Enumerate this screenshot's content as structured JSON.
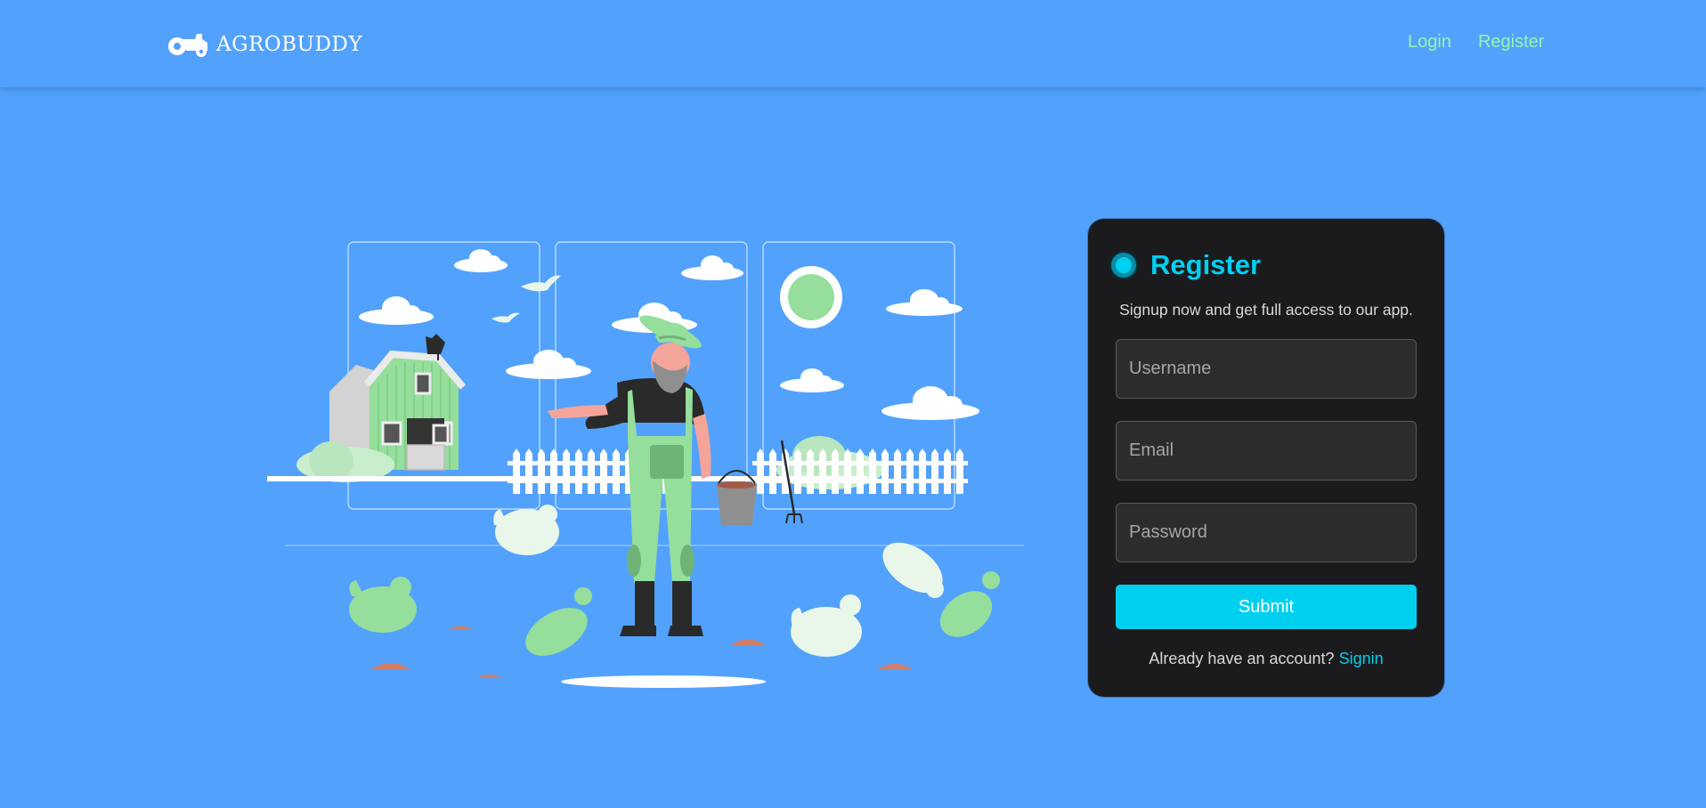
{
  "nav": {
    "brand": "AGROBUDDY",
    "login": "Login",
    "register": "Register"
  },
  "form": {
    "title": "Register",
    "subtitle": "Signup now and get full access to our app.",
    "username_placeholder": "Username",
    "email_placeholder": "Email",
    "password_placeholder": "Password",
    "submit_label": "Submit",
    "footer_text": "Already have an account?",
    "signin_label": "Signin"
  },
  "colors": {
    "background": "#52a2fd",
    "card": "#1b1b1d",
    "accent": "#00d0f0",
    "nav_link": "#9af2b0",
    "illustration_green": "#95de9c"
  },
  "icons": {
    "logo": "tractor-icon"
  }
}
